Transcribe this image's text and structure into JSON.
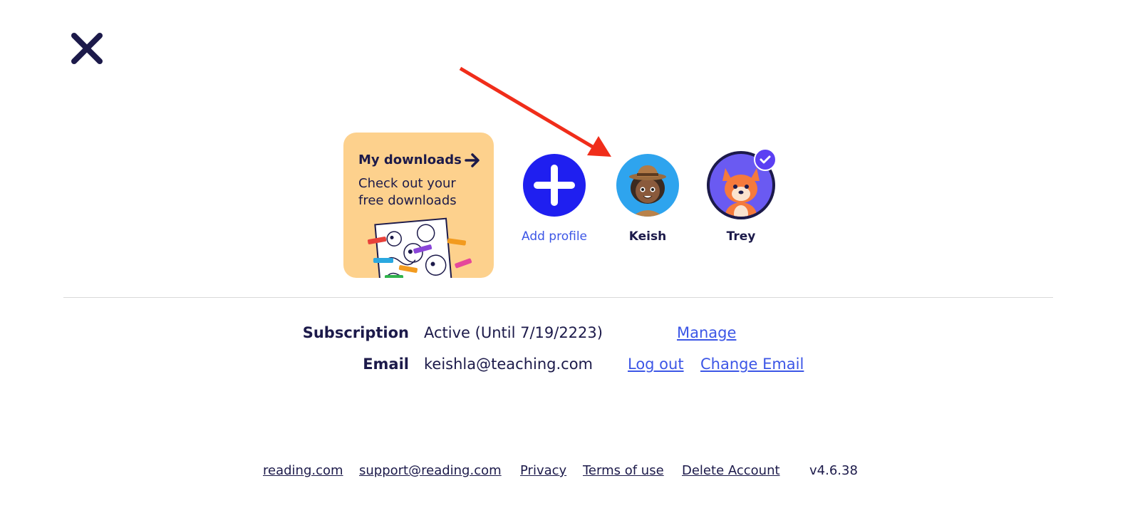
{
  "header": {
    "close_icon": "close-icon"
  },
  "colors": {
    "accent": "#3c56e6",
    "card": "#fdd18d",
    "text": "#1c1a4a",
    "annotation": "#f02d1a",
    "selected_badge": "#5b3ff3"
  },
  "downloads_card": {
    "title": "My downloads",
    "subtitle": "Check out your free downloads",
    "arrow_icon": "arrow-right-icon"
  },
  "profiles": [
    {
      "name": "Add profile",
      "icon": "plus-icon"
    },
    {
      "name": "Keish",
      "icon": "ranger-girl-avatar-icon"
    },
    {
      "name": "Trey",
      "icon": "fox-avatar-icon",
      "selected": true
    }
  ],
  "account": {
    "subscription_label": "Subscription",
    "subscription_value": "Active (Until 7/19/2223)",
    "manage_link": "Manage",
    "email_label": "Email",
    "email_value": "keishla@teaching.com",
    "logout_link": "Log out",
    "change_email_link": "Change Email"
  },
  "footer": {
    "links": [
      "reading.com",
      "support@reading.com",
      "Privacy",
      "Terms of use",
      "Delete Account"
    ],
    "version": "v4.6.38"
  }
}
